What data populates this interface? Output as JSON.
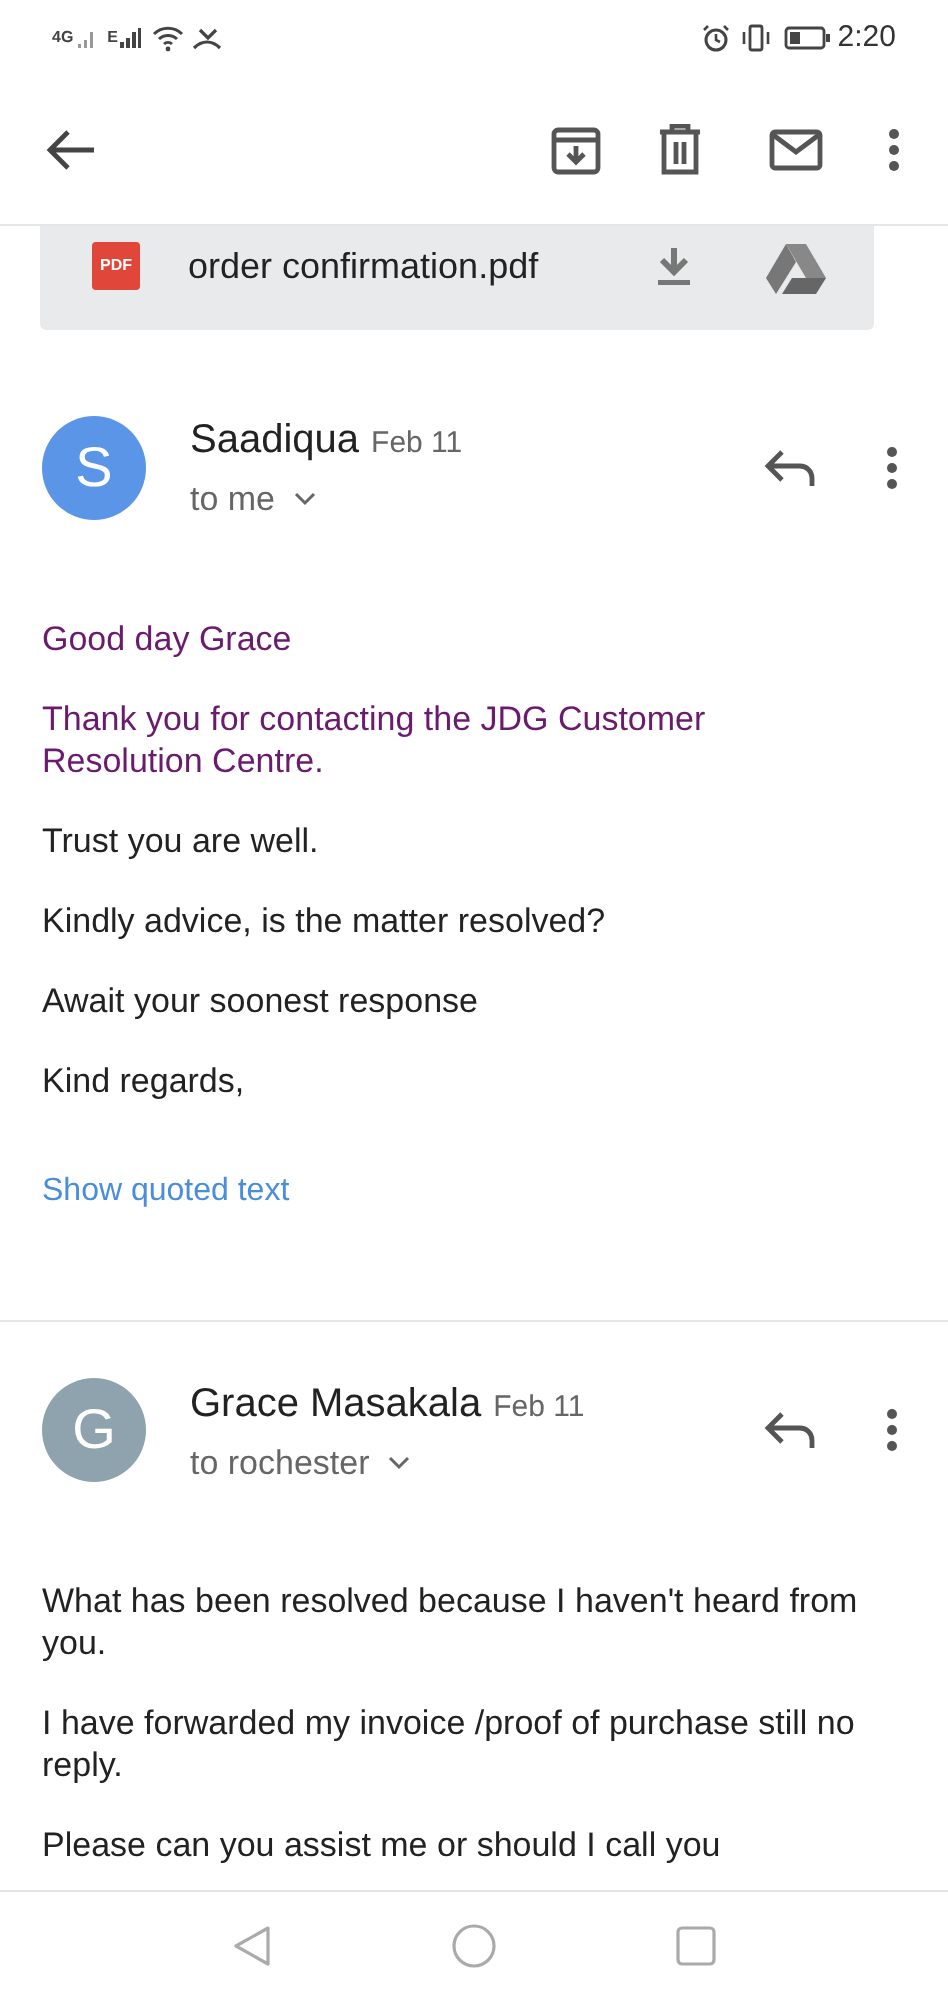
{
  "status_bar": {
    "network_1": "4G",
    "network_2": "E",
    "time": "2:20"
  },
  "attachment": {
    "file_name": "order confirmation.pdf",
    "file_type": "PDF"
  },
  "messages": [
    {
      "initial": "S",
      "color": "#5b95e8",
      "sender": "Saadiqua",
      "date": "Feb 11",
      "recipients": "to me",
      "paragraphs": [
        {
          "text": "Good day Grace",
          "color": "#6a1b6e"
        },
        {
          "text": "Thank you for contacting the JDG Customer Resolution Centre.",
          "color": "#6a1b6e"
        },
        {
          "text": "Trust you are well.",
          "color": "#222222"
        },
        {
          "text": "Kindly advice, is the matter resolved?",
          "color": "#222222"
        },
        {
          "text": "Await your soonest response",
          "color": "#222222"
        },
        {
          "text": "Kind regards,",
          "color": "#222222"
        }
      ],
      "link": "Show quoted text"
    },
    {
      "initial": "G",
      "color": "#8ea3ad",
      "sender": "Grace Masakala",
      "date": "Feb 11",
      "recipients": "to rochester",
      "paragraphs": [
        {
          "text": "What has been resolved because I haven't heard from you.",
          "color": "#222222"
        },
        {
          "text": "I have forwarded my invoice /proof of purchase still no reply.",
          "color": "#222222"
        },
        {
          "text": "Please can you assist me or should I call you",
          "color": "#222222"
        }
      ]
    }
  ]
}
